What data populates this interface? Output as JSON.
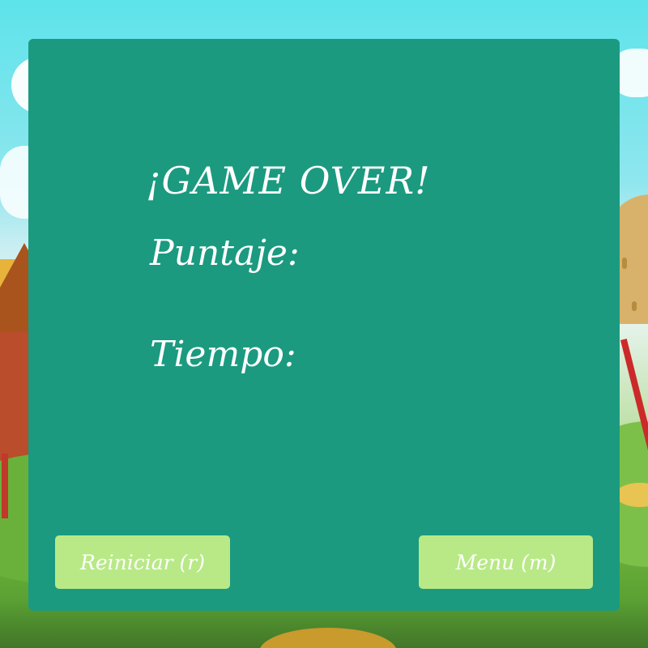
{
  "game_over": {
    "title": "¡GAME OVER!",
    "score_label": "Puntaje:",
    "score_value": "",
    "time_label": "Tiempo:",
    "time_value": ""
  },
  "buttons": {
    "restart_label": "Reiniciar (r)",
    "menu_label": "Menu (m)"
  },
  "colors": {
    "panel": "#1b9a80",
    "button": "#b8e986",
    "text": "#ffffff"
  }
}
